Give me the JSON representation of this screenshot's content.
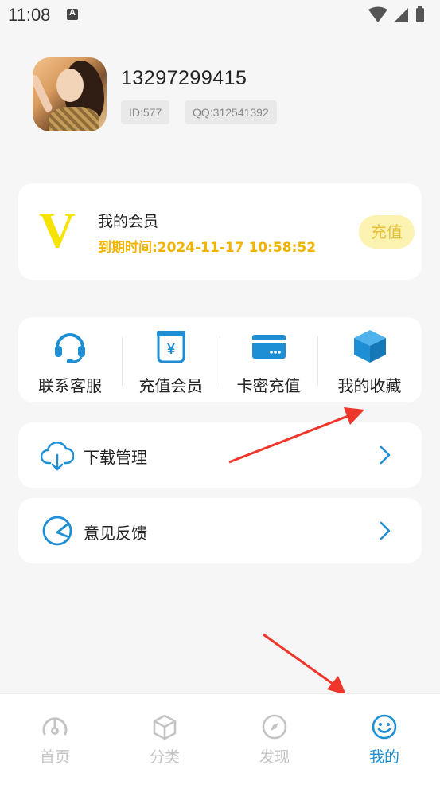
{
  "status_bar": {
    "time": "11:08",
    "notification_letter": "A"
  },
  "profile": {
    "phone": "13297299415",
    "id_chip": "ID:577",
    "qq_chip": "QQ:312541392"
  },
  "vip": {
    "logo_letter": "V",
    "title": "我的会员",
    "expiry": "到期时间:2024-11-17 10:58:52",
    "recharge_label": "充值"
  },
  "quick_actions": [
    {
      "label": "联系客服",
      "icon": "headset-icon"
    },
    {
      "label": "充值会员",
      "icon": "yuan-bag-icon"
    },
    {
      "label": "卡密充值",
      "icon": "card-icon"
    },
    {
      "label": "我的收藏",
      "icon": "cube-icon"
    }
  ],
  "menu_rows": [
    {
      "label": "下载管理",
      "icon": "cloud-download-icon"
    },
    {
      "label": "意见反馈",
      "icon": "feedback-icon"
    }
  ],
  "tabbar": {
    "active_index": 3,
    "items": [
      {
        "label": "首页",
        "icon": "gauge-icon"
      },
      {
        "label": "分类",
        "icon": "box-icon"
      },
      {
        "label": "发现",
        "icon": "compass-icon"
      },
      {
        "label": "我的",
        "icon": "smiley-icon"
      }
    ]
  },
  "colors": {
    "accent": "#1e8fd5",
    "vip_gold": "#f0b400",
    "arrow_red": "#f0352a"
  }
}
